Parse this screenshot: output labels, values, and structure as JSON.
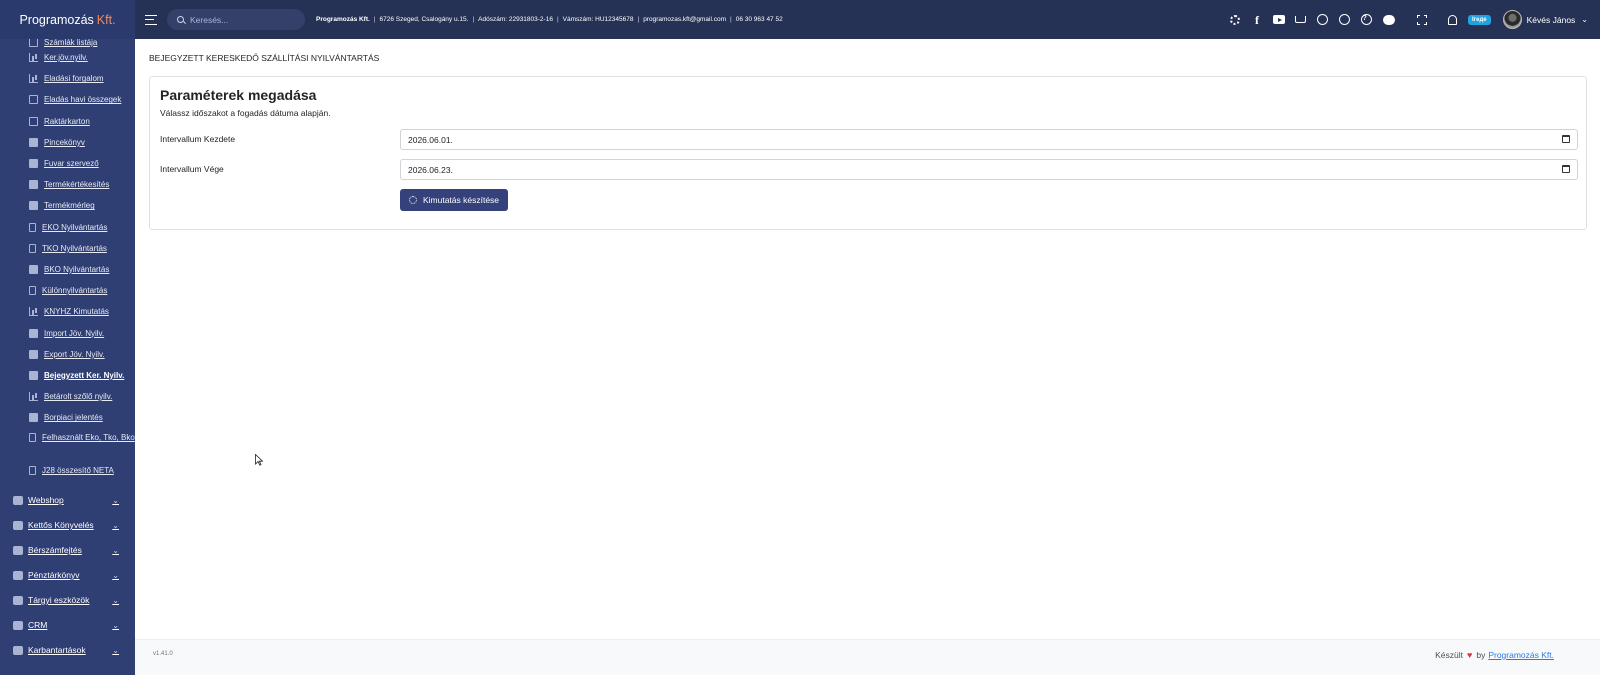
{
  "brand": {
    "name": "Programozás",
    "suffix": "Kft."
  },
  "sidebar": {
    "cut_item": "Számlák listája",
    "items": [
      {
        "label": "Ker.jöv.nyilv.",
        "icon": "bar-chart-icon"
      },
      {
        "label": "Eladási forgalom",
        "icon": "bar-chart-icon"
      },
      {
        "label": "Eladás havi összegek",
        "icon": "calendar-icon"
      },
      {
        "label": "Raktárkarton",
        "icon": "archive-icon"
      },
      {
        "label": "Pincekönyv",
        "icon": "layers-icon"
      },
      {
        "label": "Fuvar szervező",
        "icon": "truck-icon"
      },
      {
        "label": "Termékértékesítés",
        "icon": "rocket-icon"
      },
      {
        "label": "Termékmérleg",
        "icon": "scale-icon"
      },
      {
        "label": "EKO Nyilvántartás",
        "icon": "clipboard-icon"
      },
      {
        "label": "TKO Nyilvántartás",
        "icon": "clipboard-check-icon"
      },
      {
        "label": "BKO Nyilvántartás",
        "icon": "book-icon"
      },
      {
        "label": "Különnyilvántartás",
        "icon": "document-icon"
      },
      {
        "label": "KNYHZ Kimutatás",
        "icon": "line-chart-icon"
      },
      {
        "label": "Import Jöv. Nyilv.",
        "icon": "ship-icon"
      },
      {
        "label": "Export Jöv. Nyilv.",
        "icon": "plane-icon"
      },
      {
        "label": "Bejegyzett Ker. Nyilv.",
        "icon": "truck-loading-icon",
        "active": true
      },
      {
        "label": "Betárolt szőlő nyilv.",
        "icon": "bar-chart-icon"
      },
      {
        "label": "Borpiaci jelentés",
        "icon": "pie-chart-icon"
      },
      {
        "label": "Felhasznált Eko, Tko, Bko",
        "icon": "document-icon"
      },
      {
        "label": "J28 összesítő NETA",
        "icon": "document-icon"
      }
    ],
    "sections": [
      {
        "label": "Webshop",
        "icon": "shop-icon"
      },
      {
        "label": "Kettős Könyvelés",
        "icon": "ledger-icon"
      },
      {
        "label": "Bérszámfejtés",
        "icon": "user-icon"
      },
      {
        "label": "Pénztárkönyv",
        "icon": "book-open-icon"
      },
      {
        "label": "Tárgyi eszközök",
        "icon": "boxes-icon"
      },
      {
        "label": "CRM",
        "icon": "crm-icon"
      },
      {
        "label": "Karbantartások",
        "icon": "gear-icon"
      }
    ]
  },
  "topbar": {
    "search_placeholder": "Keresés...",
    "company_name": "Programozás Kft.",
    "address": "6726 Szeged, Csalogány u.15.",
    "tax_id": "Adószám: 22931803-2-16",
    "customs_id": "Vámszám: HU12345678",
    "email": "programozas.kft@gmail.com",
    "phone": "06 30 963 47 52",
    "badge": "Ігеде",
    "user_name": "Kévés János"
  },
  "main": {
    "page_title": "BEJEGYZETT KERESKEDŐ SZÁLLÍTÁSI NYILVÁNTARTÁS",
    "card_title": "Paraméterek megadása",
    "card_subtitle": "Válassz időszakot a fogadás dátuma alapján.",
    "start_label": "Intervallum Kezdete",
    "start_value": "2026.06.01.",
    "end_label": "Intervallum Vége",
    "end_value": "2026.06.23.",
    "submit_label": "Kimutatás készítése"
  },
  "footer": {
    "version": "v1.41.0",
    "made_prefix": "Készült",
    "made_by": "by",
    "made_link": "Programozás Kft."
  },
  "colors": {
    "sidebar_bg": "#2f3e73",
    "topbar_bg": "#263255",
    "button_bg": "#34417a",
    "badge_bg": "#1fa2e0",
    "heart": "#e0323c"
  }
}
